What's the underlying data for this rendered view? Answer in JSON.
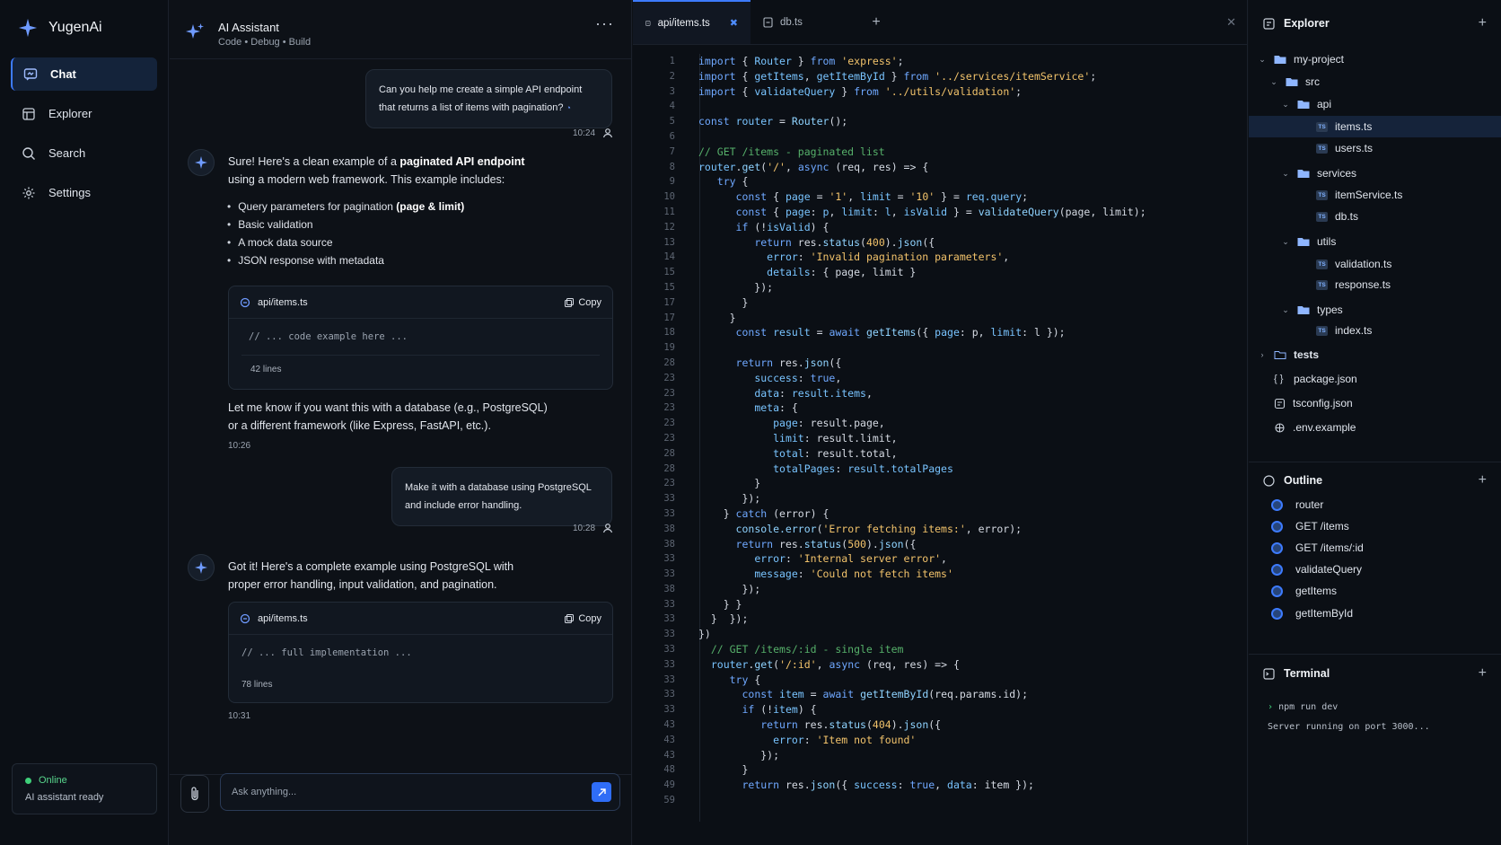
{
  "app": {
    "name": "YugenAi"
  },
  "nav": {
    "items": [
      {
        "label": "Chat",
        "icon": "chat-icon"
      },
      {
        "label": "Explorer",
        "icon": "explorer-icon"
      },
      {
        "label": "Search",
        "icon": "search-icon"
      },
      {
        "label": "Settings",
        "icon": "gear-icon"
      }
    ]
  },
  "status": {
    "state": "Online",
    "message": "AI assistant ready"
  },
  "chat": {
    "title": "AI Assistant",
    "subtitle": "Code • Debug • Build",
    "messages": [
      {
        "role": "user",
        "lines": [
          "Can you help me create a simple API endpoint",
          "that returns a list of items with pagination?"
        ],
        "time": "10:24"
      },
      {
        "role": "assistant",
        "intro_a": "Sure! Here's a clean example of a ",
        "intro_bold": "paginated API endpoint",
        "intro_b": "using a modern web framework. This example includes:",
        "bullets": [
          "Query parameters for pagination ",
          "Basic validation",
          "A mock data source",
          "JSON response with metadata"
        ],
        "bullet_bold": "(page & limit)",
        "code": {
          "file": "api/items.ts",
          "copy": "Copy",
          "body": "// ... code example here ...",
          "lines": "42 lines"
        },
        "outro": [
          "Let me know if you want this with a database (e.g., PostgreSQL)",
          "or a different framework (like Express, FastAPI, etc.)."
        ],
        "time": "10:26"
      },
      {
        "role": "user",
        "lines": [
          "Make it with a database using PostgreSQL",
          "and include error handling."
        ],
        "time": "10:28"
      },
      {
        "role": "assistant",
        "intro": [
          "Got it! Here's a complete example using PostgreSQL with",
          "proper error handling, input validation, and pagination."
        ],
        "code": {
          "file": "api/items.ts",
          "copy": "Copy",
          "body": "// ... full implementation ...",
          "lines": "78 lines"
        },
        "time": "10:31"
      }
    ],
    "input_placeholder": "Ask anything..."
  },
  "editor": {
    "tabs": [
      {
        "label": "api/items.ts",
        "close": "✖"
      },
      {
        "label": "db.ts"
      }
    ],
    "tab_add": "+",
    "line_numbers": [
      "1",
      "2",
      "3",
      "4",
      "5",
      "6",
      "7",
      "8",
      "9",
      "10",
      "11",
      "12",
      "13",
      "14",
      "15",
      "15",
      "17",
      "17",
      "18",
      "19",
      "28",
      "23",
      "23",
      "23",
      "23",
      "23",
      "28",
      "28",
      "23",
      "33",
      "33",
      "38",
      "38",
      "33",
      "33",
      "38",
      "33",
      "33",
      "33",
      "33",
      "33",
      "33",
      "33",
      "33",
      "43",
      "43",
      "43",
      "48",
      "49",
      "59"
    ]
  },
  "explorer": {
    "title": "Explorer",
    "tree": [
      {
        "label": "my-project",
        "depth": 0,
        "type": "folder",
        "open": true
      },
      {
        "label": "src",
        "depth": 1,
        "type": "folder",
        "open": true
      },
      {
        "label": "api",
        "depth": 2,
        "type": "folder",
        "open": true
      },
      {
        "label": "items.ts",
        "depth": 3,
        "type": "ts",
        "selected": true
      },
      {
        "label": "users.ts",
        "depth": 3,
        "type": "ts"
      },
      {
        "label": "services",
        "depth": 2,
        "type": "folder",
        "open": true
      },
      {
        "label": "itemService.ts",
        "depth": 3,
        "type": "ts"
      },
      {
        "label": "db.ts",
        "depth": 3,
        "type": "ts"
      },
      {
        "label": "utils",
        "depth": 2,
        "type": "folder",
        "open": true
      },
      {
        "label": "validation.ts",
        "depth": 3,
        "type": "ts"
      },
      {
        "label": "response.ts",
        "depth": 3,
        "type": "ts"
      },
      {
        "label": "types",
        "depth": 2,
        "type": "folder",
        "open": true
      },
      {
        "label": "index.ts",
        "depth": 3,
        "type": "ts"
      },
      {
        "label": "tests",
        "depth": 0,
        "type": "folder",
        "open": false
      },
      {
        "label": "package.json",
        "depth": 0,
        "type": "json"
      },
      {
        "label": "tsconfig.json",
        "depth": 0,
        "type": "config"
      },
      {
        "label": ".env.example",
        "depth": 0,
        "type": "env"
      }
    ]
  },
  "outline": {
    "title": "Outline",
    "items": [
      "router",
      "GET /items",
      "GET /items/:id",
      "validateQuery",
      "getItems",
      "getItemById"
    ]
  },
  "terminal": {
    "title": "Terminal",
    "command": "npm run dev",
    "output": "Server running on port 3000..."
  },
  "colors": {
    "accent": "#3d7bff",
    "online": "#3fd07a",
    "background": "#0d1117"
  }
}
